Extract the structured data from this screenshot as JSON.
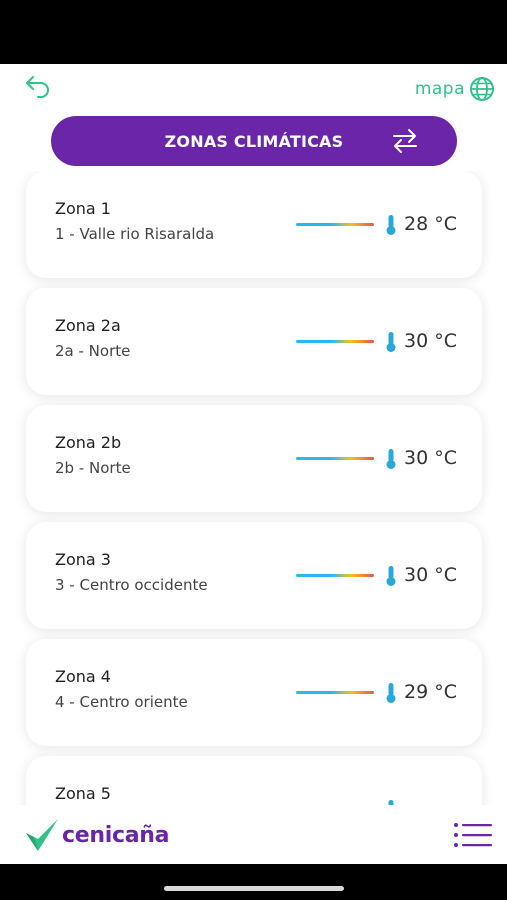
{
  "topbar": {
    "map_label": "mapa"
  },
  "header": {
    "title": "ZONAS CLIMÁTICAS"
  },
  "zones": [
    {
      "name": "Zona 1",
      "desc": "1 - Valle rio Risaralda",
      "temp": "28 °C"
    },
    {
      "name": "Zona 2a",
      "desc": "2a - Norte",
      "temp": "30 °C"
    },
    {
      "name": "Zona 2b",
      "desc": "2b - Norte",
      "temp": "30 °C"
    },
    {
      "name": "Zona 3",
      "desc": "3 - Centro occidente",
      "temp": "30 °C"
    },
    {
      "name": "Zona 4",
      "desc": "4 - Centro oriente",
      "temp": "29 °C"
    },
    {
      "name": "Zona 5",
      "desc": "",
      "temp": ""
    }
  ],
  "footer": {
    "logo_text": "cenicaña"
  },
  "colors": {
    "brand_purple": "#6a25a8",
    "accent_green": "#2fc28a",
    "thermo_blue": "#29a9d8"
  },
  "icons": [
    "back-arrow-icon",
    "globe-icon",
    "swap-arrows-icon",
    "thermometer-icon",
    "menu-icon",
    "cenicana-leaf-logo"
  ]
}
